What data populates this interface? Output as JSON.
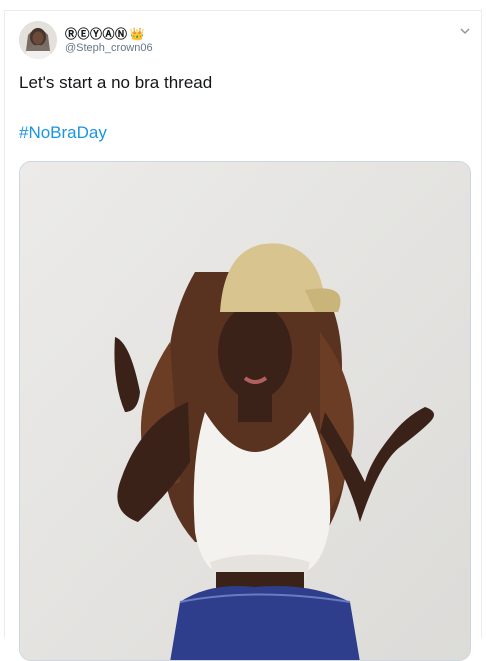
{
  "tweet": {
    "display_name": "ⓇⒺⓎⒶⓃ",
    "handle": "@Steph_crown06",
    "text": "Let's start a no bra thread",
    "hashtag": "#NoBraDay"
  },
  "icons": {
    "badge": "crown-icon",
    "menu": "chevron-down-icon"
  },
  "colors": {
    "link": "#1b95e0",
    "secondary_text": "#657786",
    "border": "#e6ecf0"
  }
}
